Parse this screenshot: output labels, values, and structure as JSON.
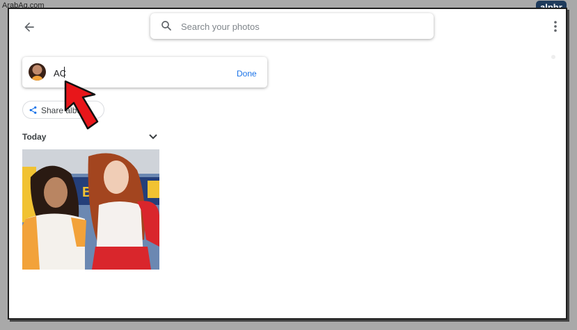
{
  "watermarks": {
    "left": "ArabAq.com",
    "right": "alphr"
  },
  "search": {
    "placeholder": "Search your photos"
  },
  "name_card": {
    "value": "AC",
    "done_label": "Done"
  },
  "share_button": {
    "label": "Share album"
  },
  "section": {
    "heading": "Today"
  },
  "icons": {
    "back": "back-arrow-icon",
    "search": "search-icon",
    "more": "more-vert-icon",
    "share": "share-icon",
    "chevron": "chevron-down-icon",
    "pointer": "red-pointer-arrow"
  },
  "colors": {
    "accent": "#1a73e8",
    "pointer": "#e8161a"
  }
}
